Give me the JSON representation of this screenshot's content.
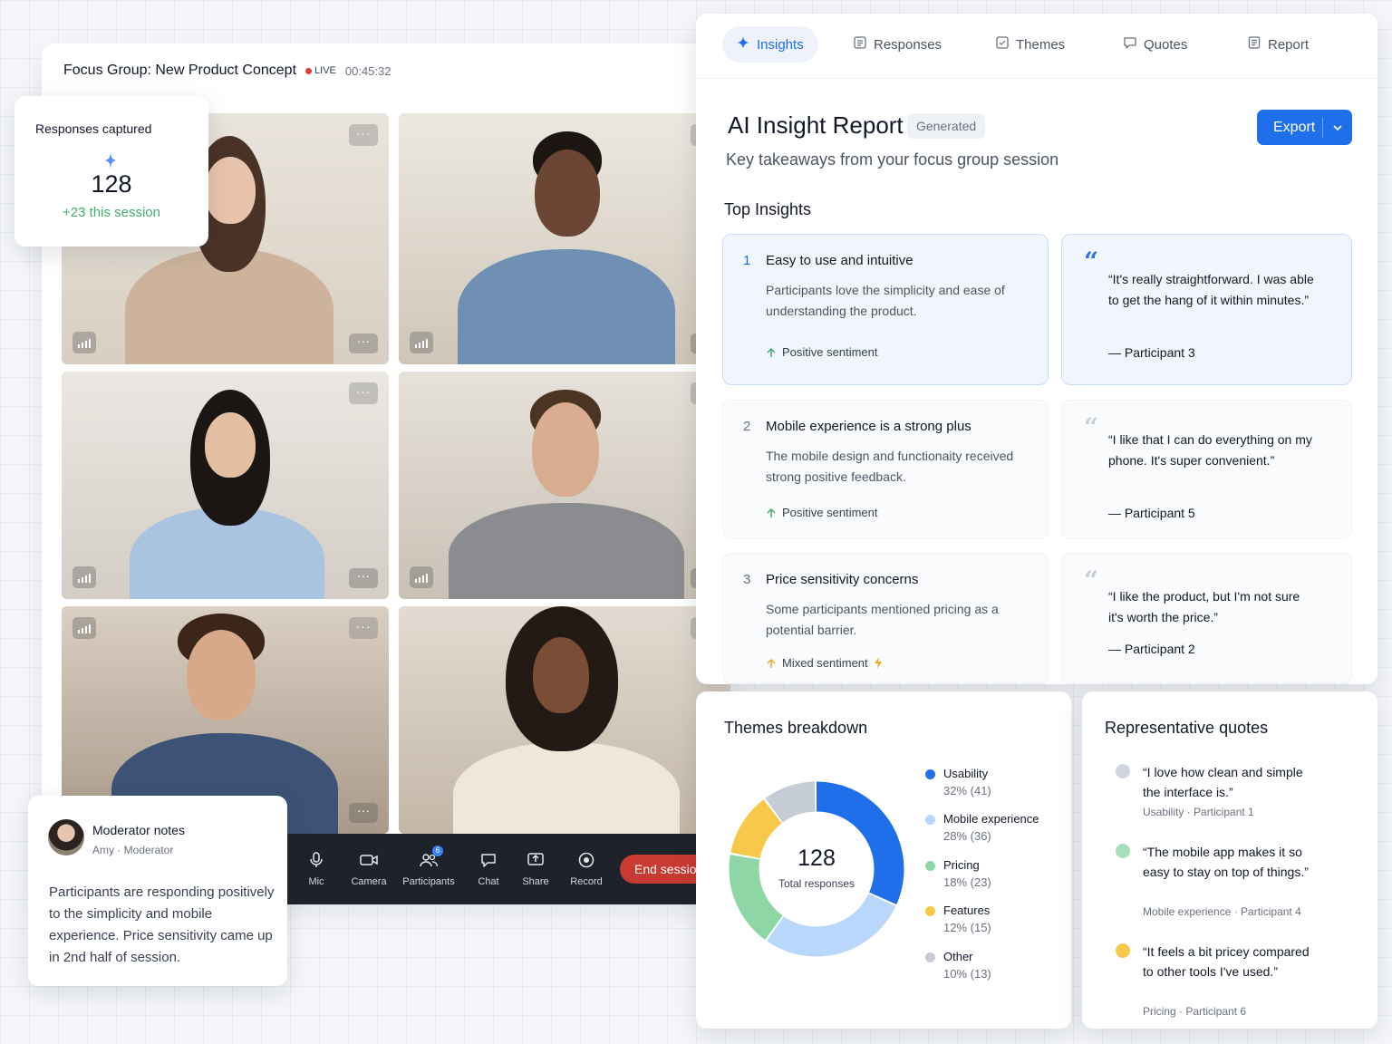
{
  "call": {
    "title": "Focus Group: New Product Concept",
    "live_label": "LIVE",
    "timer": "00:45:32",
    "toolbar": {
      "mic": "Mic",
      "camera": "Camera",
      "participants": "Participants",
      "participants_badge": "6",
      "chat": "Chat",
      "share": "Share",
      "record": "Record",
      "end": "End session"
    },
    "tile_menu": "···"
  },
  "responses_card": {
    "title": "Responses captured",
    "count": "128",
    "delta": "+23 this session"
  },
  "notes": {
    "title": "Moderator notes",
    "author": "Amy · Moderator",
    "body": "Participants are responding positively to the simplicity and mobile experience. Price sensitivity came up in 2nd half of session."
  },
  "panel": {
    "tabs": [
      {
        "label": "Insights",
        "icon": "sparkle-icon",
        "active": true
      },
      {
        "label": "Responses",
        "icon": "list-icon",
        "active": false
      },
      {
        "label": "Themes",
        "icon": "tag-icon",
        "active": false
      },
      {
        "label": "Quotes",
        "icon": "quote-bubble-icon",
        "active": false
      },
      {
        "label": "Report",
        "icon": "document-icon",
        "active": false
      }
    ],
    "title": "AI Insight Report",
    "badge": "Generated",
    "subtitle": "Key takeaways from your focus group session",
    "export": "Export",
    "section_title": "Top Insights",
    "insights": [
      {
        "num": "1",
        "title": "Easy to use and intuitive",
        "desc": "Participants love the simplicity and ease of understanding the product.",
        "sentiment": "Positive sentiment",
        "quote": "“It's really straightforward. I was able to get the hang of it within minutes.”",
        "by": "— Participant 3"
      },
      {
        "num": "2",
        "title": "Mobile experience is a strong plus",
        "desc": "The mobile design and functionaity received strong positive feedback.",
        "sentiment": "Positive sentiment",
        "quote": "“I like that I can do everything on my phone. It's super convenient.”",
        "by": "— Participant 5"
      },
      {
        "num": "3",
        "title": "Price sensitivity concerns",
        "desc": "Some participants mentioned pricing as a potential barrier.",
        "sentiment": "Mixed sentiment",
        "quote": "“I like the product, but I'm not sure it's worth the price.”",
        "by": "— Participant 2"
      }
    ]
  },
  "themes": {
    "title": "Themes breakdown",
    "total": "128",
    "total_label": "Total responses",
    "items": [
      {
        "name": "Usability",
        "value": "32% (41)",
        "pct": 32,
        "color": "#1f6feb"
      },
      {
        "name": "Mobile experience",
        "value": "28% (36)",
        "pct": 28,
        "color": "#b9d6fb"
      },
      {
        "name": "Pricing",
        "value": "18% (23)",
        "pct": 18,
        "color": "#8fd6a6"
      },
      {
        "name": "Features",
        "value": "12% (15)",
        "pct": 12,
        "color": "#f8c84a"
      },
      {
        "name": "Other",
        "value": "10% (13)",
        "pct": 10,
        "color": "#c6ccd5"
      }
    ]
  },
  "rep_quotes": {
    "title": "Representative quotes",
    "items": [
      {
        "text": "“I love how clean and simple the interface is.”",
        "meta": "Usability · Participant 1",
        "color": "#cfd6e2"
      },
      {
        "text": "“The mobile app makes it so easy to stay on top of things.”",
        "meta": "Mobile experience · Participant 4",
        "color": "#a6e0bb"
      },
      {
        "text": "“It feels a bit pricey compared to other tools I've used.”",
        "meta": "Pricing · Participant 6",
        "color": "#f8c84a"
      }
    ]
  }
}
